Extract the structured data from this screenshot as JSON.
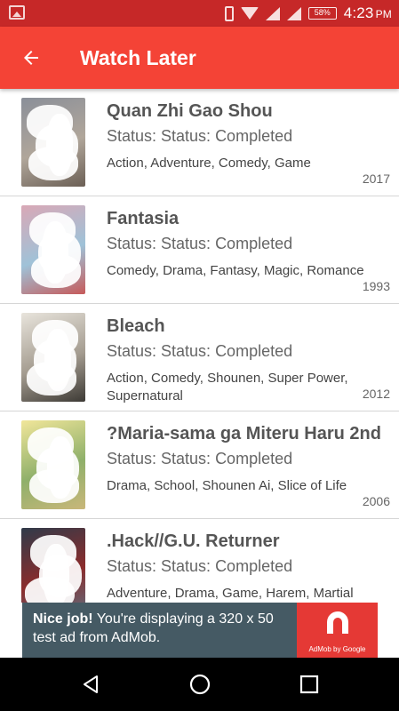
{
  "status_bar": {
    "battery": "58%",
    "time": "4:23",
    "ampm": "PM",
    "icons": [
      "image-icon",
      "phone-icon",
      "wifi-icon",
      "signal-icon",
      "signal-icon",
      "battery-icon"
    ]
  },
  "app_bar": {
    "title": "Watch Later",
    "back_icon": "arrow-back-icon",
    "color": "#f44336"
  },
  "items": [
    {
      "title": "Quan Zhi Gao Shou",
      "status": "Status: Status: Completed",
      "genres": "Action, Adventure, Comedy, Game",
      "year": "2017",
      "thumb_colors": [
        "#8a8f99",
        "#b0a69a",
        "#6b5f55"
      ]
    },
    {
      "title": "Fantasia",
      "status": "Status: Status: Completed",
      "genres": "Comedy, Drama, Fantasy, Magic, Romance",
      "year": "1993",
      "thumb_colors": [
        "#d9a8b6",
        "#9fc2d8",
        "#c65a5a"
      ]
    },
    {
      "title": "Bleach",
      "status": "Status: Status: Completed",
      "genres": "Action, Comedy, Shounen, Super Power, Supernatural",
      "year": "2012",
      "thumb_colors": [
        "#e8e4dc",
        "#a49c90",
        "#3d3a35"
      ]
    },
    {
      "title": "?Maria-sama ga Miteru Haru 2nd",
      "status": "Status: Status: Completed",
      "genres": "Drama, School, Shounen Ai, Slice of Life",
      "year": "2006",
      "thumb_colors": [
        "#f1e69a",
        "#8fb06a",
        "#c9b77a"
      ]
    },
    {
      "title": ".Hack//G.U. Returner",
      "status": "Status: Status: Completed",
      "genres": "Adventure, Drama, Game, Harem, Martial",
      "year": "",
      "thumb_colors": [
        "#2f3b4a",
        "#8b2c2c",
        "#5f6f80"
      ]
    }
  ],
  "ad": {
    "bold": "Nice job!",
    "text": " You're displaying a 320 x 50 test ad from AdMob.",
    "logo_caption": "AdMob by Google",
    "bg_color": "#455a64",
    "logo_color": "#e53935"
  },
  "nav": {
    "back_icon": "nav-back-icon",
    "home_icon": "nav-home-icon",
    "recents_icon": "nav-recents-icon"
  }
}
